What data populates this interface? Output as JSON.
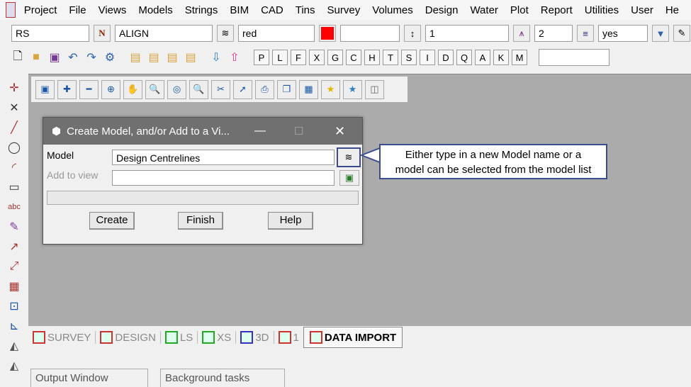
{
  "menu": [
    "Project",
    "File",
    "Views",
    "Models",
    "Strings",
    "BIM",
    "CAD",
    "Tins",
    "Survey",
    "Volumes",
    "Design",
    "Water",
    "Plot",
    "Report",
    "Utilities",
    "User",
    "He"
  ],
  "toolbar1": {
    "name": "RS",
    "model": "ALIGN",
    "colour": "red",
    "colour_hex": "#ff0000",
    "blank": "",
    "weight": "1",
    "style": "2",
    "flag": "yes"
  },
  "toolbar2": {
    "letters": [
      "P",
      "L",
      "F",
      "X",
      "G",
      "C",
      "H",
      "T",
      "S",
      "I",
      "D",
      "Q",
      "A",
      "K",
      "M"
    ]
  },
  "dialog": {
    "title": "Create Model, and/or Add to a Vi...",
    "model_label": "Model",
    "model_value": "Design Centrelines",
    "view_label": "Add to view",
    "view_value": "",
    "create": "Create",
    "finish": "Finish",
    "help": "Help"
  },
  "callout": {
    "line1": "Either type in a new Model name or a",
    "line2": "model can be selected from the model list",
    "border": "#3b4d8f"
  },
  "tabs": [
    "SURVEY",
    "DESIGN",
    "LS",
    "XS",
    "3D",
    "1",
    "DATA IMPORT"
  ],
  "panels": {
    "output": "Output Window",
    "background": "Background tasks"
  }
}
